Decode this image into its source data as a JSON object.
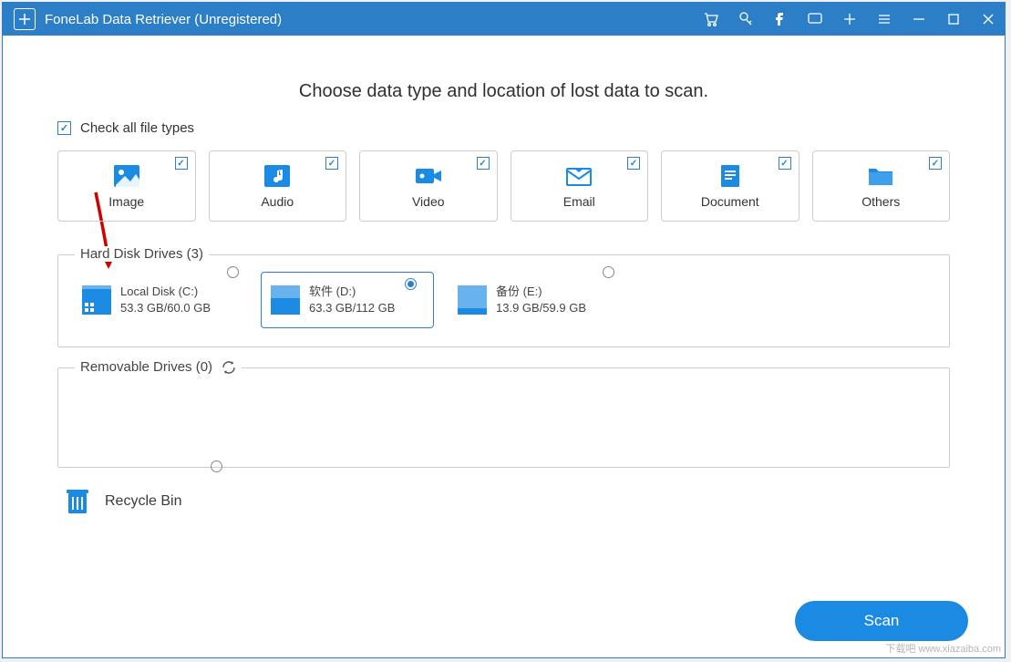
{
  "window": {
    "title": "FoneLab Data Retriever (Unregistered)"
  },
  "heading": "Choose data type and location of lost data to scan.",
  "checkAll": {
    "label": "Check all file types",
    "checked": true
  },
  "types": [
    {
      "name": "Image",
      "checked": true,
      "icon": "image"
    },
    {
      "name": "Audio",
      "checked": true,
      "icon": "audio"
    },
    {
      "name": "Video",
      "checked": true,
      "icon": "video"
    },
    {
      "name": "Email",
      "checked": true,
      "icon": "email"
    },
    {
      "name": "Document",
      "checked": true,
      "icon": "document"
    },
    {
      "name": "Others",
      "checked": true,
      "icon": "folder"
    }
  ],
  "hdd": {
    "title": "Hard Disk Drives (3)",
    "drives": [
      {
        "name": "Local Disk (C:)",
        "size": "53.3 GB/60.0 GB",
        "fillPct": 88,
        "selected": false,
        "isSystem": true
      },
      {
        "name": "软件 (D:)",
        "size": "63.3 GB/112 GB",
        "fillPct": 56,
        "selected": true,
        "isSystem": false
      },
      {
        "name": "备份 (E:)",
        "size": "13.9 GB/59.9 GB",
        "fillPct": 23,
        "selected": false,
        "isSystem": false
      }
    ]
  },
  "removable": {
    "title": "Removable Drives (0)"
  },
  "recycle": {
    "label": "Recycle Bin",
    "selected": false
  },
  "scan": {
    "label": "Scan"
  },
  "accent": "#1b8ae3",
  "watermark": "下载吧 www.xiazaiba.com"
}
